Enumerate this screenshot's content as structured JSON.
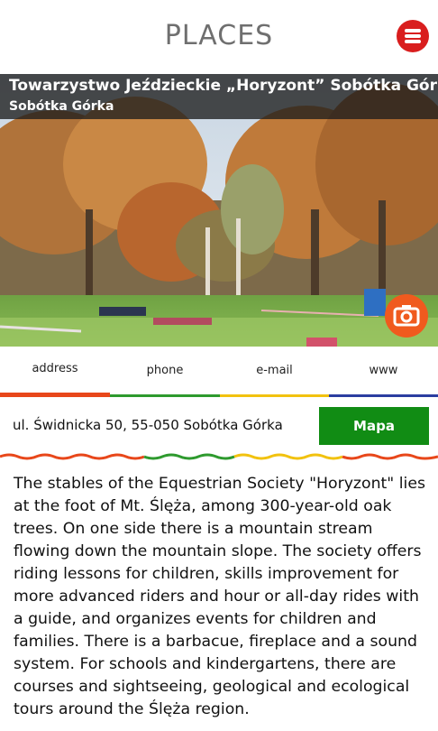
{
  "header": {
    "title": "PLACES",
    "menu_icon": "hamburger-icon",
    "menu_color": "#d91e1e"
  },
  "place": {
    "name": "Towarzystwo Jeździeckie „Horyzont”  Sobótka Górka",
    "city": "Sobótka Górka",
    "photo_icon": "camera-icon",
    "photo_button_color": "#f05a1e"
  },
  "tabs": [
    {
      "label": "address",
      "color": "#e8471a",
      "active": true
    },
    {
      "label": "phone",
      "color": "#2e9a2e",
      "active": false
    },
    {
      "label": "e-mail",
      "color": "#f2c20f",
      "active": false
    },
    {
      "label": "www",
      "color": "#2b3da0",
      "active": false
    }
  ],
  "address": {
    "text": "ul. Świdnicka 50, 55-050 Sobótka Górka",
    "map_button": "Mapa",
    "map_button_color": "#118c14"
  },
  "description": "The stables of the Equestrian Society \"Horyzont\" lies at the foot of Mt. Ślęża, among 300-year-old oak trees. On one side there is a mountain stream flowing down the mountain slope. The society offers riding lessons for children, skills improvement for more advanced riders and hour or all-day rides with a guide, and organizes events for children and families. There is a barbacue, fireplace and a sound system. For schools and kindergartens, there are courses and sightseeing, geological and ecological tours around the Ślęża region."
}
